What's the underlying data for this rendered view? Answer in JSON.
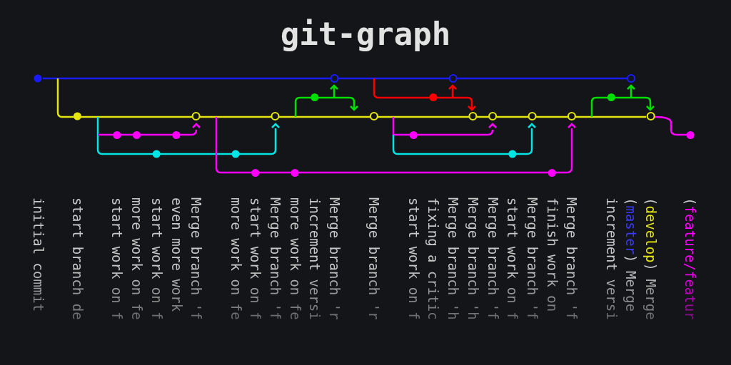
{
  "title": "git-graph",
  "commits": [
    {
      "color": "#1a1aff",
      "merge": false,
      "segments": [
        {
          "text": "initial commit",
          "color": "#c8c8c8"
        }
      ]
    },
    {
      "color": "#e5e510",
      "merge": false,
      "segments": [
        {
          "text": "start branch de",
          "color": "#c8c8c8"
        }
      ]
    },
    {
      "color": "#ff00ff",
      "merge": false,
      "segments": [
        {
          "text": "start work on f",
          "color": "#c8c8c8"
        }
      ]
    },
    {
      "color": "#ff00ff",
      "merge": false,
      "segments": [
        {
          "text": "more work on fe",
          "color": "#c8c8c8"
        }
      ]
    },
    {
      "color": "#00e5e5",
      "merge": false,
      "segments": [
        {
          "text": "start work on f",
          "color": "#c8c8c8"
        }
      ]
    },
    {
      "color": "#ff00ff",
      "merge": false,
      "segments": [
        {
          "text": "even more work",
          "color": "#c8c8c8"
        }
      ]
    },
    {
      "color": "#e5e510",
      "merge": true,
      "segments": [
        {
          "text": "Merge branch 'f",
          "color": "#c8c8c8"
        }
      ]
    },
    {
      "color": "#00e5e5",
      "merge": false,
      "segments": [
        {
          "text": "more work on fe",
          "color": "#c8c8c8"
        }
      ]
    },
    {
      "color": "#ff00ff",
      "merge": false,
      "segments": [
        {
          "text": "start work on f",
          "color": "#c8c8c8"
        }
      ]
    },
    {
      "color": "#e5e510",
      "merge": true,
      "segments": [
        {
          "text": "Merge branch 'f",
          "color": "#c8c8c8"
        }
      ]
    },
    {
      "color": "#ff00ff",
      "merge": false,
      "segments": [
        {
          "text": "more work on fe",
          "color": "#c8c8c8"
        }
      ]
    },
    {
      "color": "#00e000",
      "merge": false,
      "segments": [
        {
          "text": "increment versi",
          "color": "#c8c8c8"
        }
      ]
    },
    {
      "color": "#1a1aff",
      "merge": true,
      "segments": [
        {
          "text": "Merge branch 'r",
          "color": "#c8c8c8"
        }
      ]
    },
    {
      "color": "#e5e510",
      "merge": true,
      "segments": [
        {
          "text": "Merge branch 'r",
          "color": "#c8c8c8"
        }
      ]
    },
    {
      "color": "#ff00ff",
      "merge": false,
      "segments": [
        {
          "text": "start work on f",
          "color": "#c8c8c8"
        }
      ]
    },
    {
      "color": "#ff0000",
      "merge": false,
      "segments": [
        {
          "text": "fixing a critic",
          "color": "#c8c8c8"
        }
      ]
    },
    {
      "color": "#1a1aff",
      "merge": true,
      "segments": [
        {
          "text": "Merge branch 'h",
          "color": "#c8c8c8"
        }
      ]
    },
    {
      "color": "#e5e510",
      "merge": true,
      "segments": [
        {
          "text": "Merge branch 'h",
          "color": "#c8c8c8"
        }
      ]
    },
    {
      "color": "#e5e510",
      "merge": true,
      "segments": [
        {
          "text": "Merge branch 'f",
          "color": "#c8c8c8"
        }
      ]
    },
    {
      "color": "#00e5e5",
      "merge": false,
      "segments": [
        {
          "text": "start work on f",
          "color": "#c8c8c8"
        }
      ]
    },
    {
      "color": "#e5e510",
      "merge": true,
      "segments": [
        {
          "text": "Merge branch 'f",
          "color": "#c8c8c8"
        }
      ]
    },
    {
      "color": "#ff00ff",
      "merge": false,
      "segments": [
        {
          "text": "finish work on",
          "color": "#c8c8c8"
        }
      ]
    },
    {
      "color": "#e5e510",
      "merge": true,
      "segments": [
        {
          "text": "Merge branch 'f",
          "color": "#c8c8c8"
        }
      ]
    },
    {
      "color": "#00e000",
      "merge": false,
      "segments": [
        {
          "text": "increment versi",
          "color": "#c8c8c8"
        }
      ]
    },
    {
      "color": "#1a1aff",
      "merge": true,
      "segments": [
        {
          "text": "(",
          "color": "#c8c8c8"
        },
        {
          "text": "master",
          "color": "#3a3aff"
        },
        {
          "text": ") Merge",
          "color": "#c8c8c8"
        }
      ]
    },
    {
      "color": "#e5e510",
      "merge": true,
      "segments": [
        {
          "text": "(",
          "color": "#c8c8c8"
        },
        {
          "text": "develop",
          "color": "#e5e510"
        },
        {
          "text": ") Merge",
          "color": "#c8c8c8"
        }
      ]
    },
    {
      "color": "#ff00ff",
      "merge": false,
      "segments": [
        {
          "text": "(",
          "color": "#c8c8c8"
        },
        {
          "text": "feature/featur",
          "color": "#ff00ff"
        }
      ]
    }
  ]
}
